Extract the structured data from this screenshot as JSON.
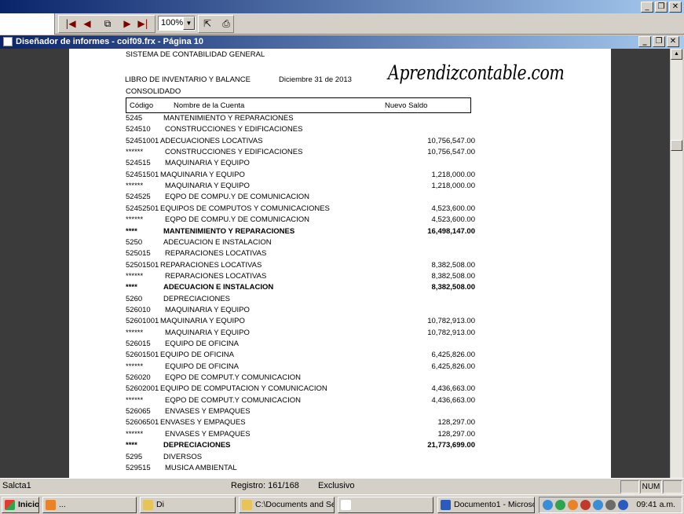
{
  "toolbar": {
    "zoom_value": "100%",
    "zoom_arrow": "▼",
    "icons": [
      "first-page-icon",
      "prev-page-icon",
      "copy-icon",
      "next-page-icon",
      "last-page-icon",
      "exit-preview-icon",
      "print-icon"
    ]
  },
  "window": {
    "title": "Diseñador de informes - coif09.frx - Página 10"
  },
  "report": {
    "header_line1": "SISTEMA DE CONTABILIDAD GENERAL",
    "header_line2": "LIBRO DE INVENTARIO Y BALANCE",
    "date": "Diciembre 31 de 2013",
    "header_line3": "CONSOLIDADO",
    "watermark": "Aprendizcontable.com",
    "col_code": "Código",
    "col_name": "Nombre de la Cuenta",
    "col_balance": "Nuevo Saldo",
    "rows": [
      {
        "code": "5245",
        "name": "MANTENIMIENTO Y REPARACIONES",
        "amount": "",
        "indent": 1,
        "bold": false
      },
      {
        "code": "524510",
        "name": "CONSTRUCCIONES Y EDIFICACIONES",
        "amount": "",
        "indent": 2,
        "bold": false
      },
      {
        "code": "52451001",
        "name": "ADECUACIONES LOCATIVAS",
        "amount": "10,756,547.00",
        "indent": 0,
        "bold": false
      },
      {
        "code": "******",
        "name": "CONSTRUCCIONES Y EDIFICACIONES",
        "amount": "10,756,547.00",
        "indent": 2,
        "bold": false
      },
      {
        "code": "524515",
        "name": "MAQUINARIA Y EQUIPO",
        "amount": "",
        "indent": 2,
        "bold": false
      },
      {
        "code": "52451501",
        "name": "MAQUINARIA Y EQUIPO",
        "amount": "1,218,000.00",
        "indent": 0,
        "bold": false
      },
      {
        "code": "******",
        "name": "MAQUINARIA Y EQUIPO",
        "amount": "1,218,000.00",
        "indent": 2,
        "bold": false
      },
      {
        "code": "524525",
        "name": "EQPO DE COMPU.Y DE COMUNICACION",
        "amount": "",
        "indent": 2,
        "bold": false
      },
      {
        "code": "52452501",
        "name": "EQUIPOS DE COMPUTOS Y COMUNICACIONES",
        "amount": "4,523,600.00",
        "indent": 0,
        "bold": false
      },
      {
        "code": "******",
        "name": "EQPO DE COMPU.Y DE COMUNICACION",
        "amount": "4,523,600.00",
        "indent": 2,
        "bold": false
      },
      {
        "code": "****",
        "name": "MANTENIMIENTO Y REPARACIONES",
        "amount": "16,498,147.00",
        "indent": 1,
        "bold": true
      },
      {
        "code": "5250",
        "name": "ADECUACION E INSTALACION",
        "amount": "",
        "indent": 1,
        "bold": false
      },
      {
        "code": "525015",
        "name": "REPARACIONES LOCATIVAS",
        "amount": "",
        "indent": 2,
        "bold": false
      },
      {
        "code": "52501501",
        "name": "REPARACIONES LOCATIVAS",
        "amount": "8,382,508.00",
        "indent": 0,
        "bold": false
      },
      {
        "code": "******",
        "name": "REPARACIONES LOCATIVAS",
        "amount": "8,382,508.00",
        "indent": 2,
        "bold": false
      },
      {
        "code": "****",
        "name": "ADECUACION E INSTALACION",
        "amount": "8,382,508.00",
        "indent": 1,
        "bold": true
      },
      {
        "code": "5260",
        "name": "DEPRECIACIONES",
        "amount": "",
        "indent": 1,
        "bold": false
      },
      {
        "code": "526010",
        "name": "MAQUINARIA Y EQUIPO",
        "amount": "",
        "indent": 2,
        "bold": false
      },
      {
        "code": "52601001",
        "name": "MAQUINARIA Y EQUIPO",
        "amount": "10,782,913.00",
        "indent": 0,
        "bold": false
      },
      {
        "code": "******",
        "name": "MAQUINARIA Y EQUIPO",
        "amount": "10,782,913.00",
        "indent": 2,
        "bold": false
      },
      {
        "code": "526015",
        "name": "EQUIPO DE OFICINA",
        "amount": "",
        "indent": 2,
        "bold": false
      },
      {
        "code": "52601501",
        "name": "EQUIPO DE OFICINA",
        "amount": "6,425,826.00",
        "indent": 0,
        "bold": false
      },
      {
        "code": "******",
        "name": "EQUIPO DE OFICINA",
        "amount": "6,425,826.00",
        "indent": 2,
        "bold": false
      },
      {
        "code": "526020",
        "name": "EQPO DE COMPUT.Y COMUNICACION",
        "amount": "",
        "indent": 2,
        "bold": false
      },
      {
        "code": "52602001",
        "name": "EQUIPO DE COMPUTACION Y COMUNICACION",
        "amount": "4,436,663.00",
        "indent": 0,
        "bold": false
      },
      {
        "code": "******",
        "name": "EQPO DE COMPUT.Y COMUNICACION",
        "amount": "4,436,663.00",
        "indent": 2,
        "bold": false
      },
      {
        "code": "526065",
        "name": "ENVASES Y EMPAQUES",
        "amount": "",
        "indent": 2,
        "bold": false
      },
      {
        "code": "52606501",
        "name": "ENVASES Y EMPAQUES",
        "amount": "128,297.00",
        "indent": 0,
        "bold": false
      },
      {
        "code": "******",
        "name": "ENVASES Y EMPAQUES",
        "amount": "128,297.00",
        "indent": 2,
        "bold": false
      },
      {
        "code": "****",
        "name": "DEPRECIACIONES",
        "amount": "21,773,699.00",
        "indent": 1,
        "bold": true
      },
      {
        "code": "5295",
        "name": "DIVERSOS",
        "amount": "",
        "indent": 1,
        "bold": false
      },
      {
        "code": "529515",
        "name": "MUSICA AMBIENTAL",
        "amount": "",
        "indent": 2,
        "bold": false
      }
    ]
  },
  "statusbar": {
    "left": "Salcta1",
    "record": "Registro: 161/168",
    "mode": "Exclusivo",
    "num": "NUM"
  },
  "taskbar": {
    "start": "Inicio",
    "items": [
      {
        "label": "...",
        "color": "#e8832a"
      },
      {
        "label": "Di",
        "color": "#e7c45a"
      },
      {
        "label": "C:\\Documents and Se...",
        "color": "#e7c45a"
      },
      {
        "label": "",
        "color": "#ffffff"
      },
      {
        "label": "Documento1 - Microso...",
        "color": "#2b5bbf"
      }
    ],
    "clock": "09:41 a.m."
  }
}
